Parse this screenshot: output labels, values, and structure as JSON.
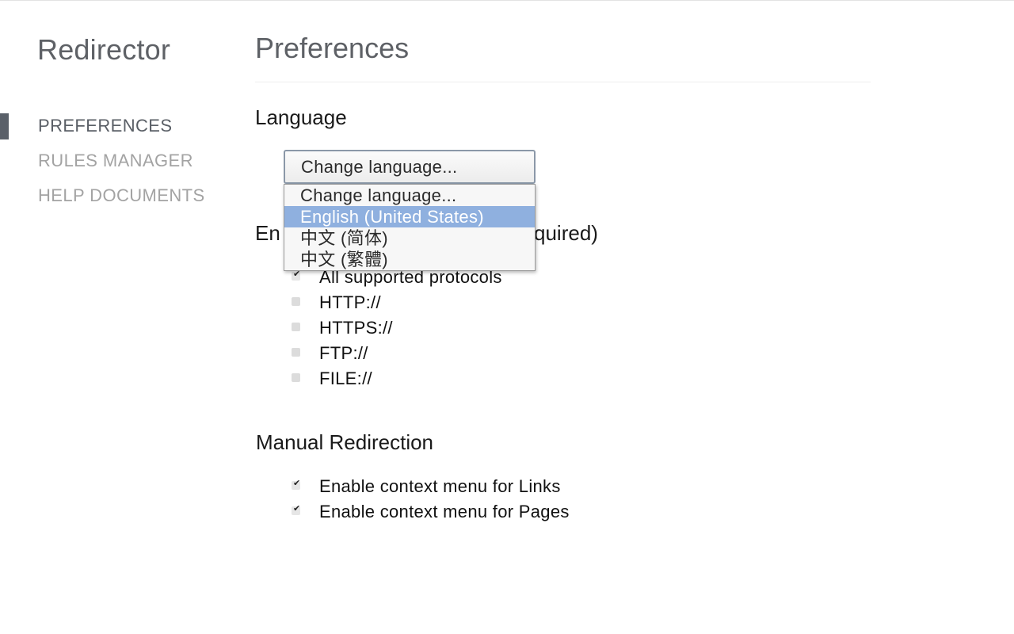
{
  "sidebar": {
    "app_title": "Redirector",
    "items": [
      {
        "label": "PREFERENCES",
        "active": true
      },
      {
        "label": "RULES MANAGER",
        "active": false
      },
      {
        "label": "HELP DOCUMENTS",
        "active": false
      }
    ]
  },
  "main": {
    "page_title": "Preferences",
    "language": {
      "title": "Language",
      "select_value": "Change language...",
      "options": [
        "Change language...",
        "English (United States)",
        "中文 (简体)",
        "中文 (繁體)"
      ],
      "highlighted_option": "English (United States)"
    },
    "protocols": {
      "title_visible_start": "En",
      "title_visible_end": "quired)",
      "items": [
        {
          "label": "All supported protocols",
          "checked": true
        },
        {
          "label": "HTTP://",
          "checked": false
        },
        {
          "label": "HTTPS://",
          "checked": false
        },
        {
          "label": "FTP://",
          "checked": false
        },
        {
          "label": "FILE://",
          "checked": false
        }
      ]
    },
    "manual": {
      "title": "Manual Redirection",
      "items": [
        {
          "label": "Enable context menu for Links",
          "checked": true
        },
        {
          "label": "Enable context menu for Pages",
          "checked": true
        }
      ]
    }
  },
  "colors": {
    "sidebar_marker": "#5a6069",
    "dropdown_highlight": "#8fb0df",
    "nav_inactive": "#a3a3a3"
  }
}
